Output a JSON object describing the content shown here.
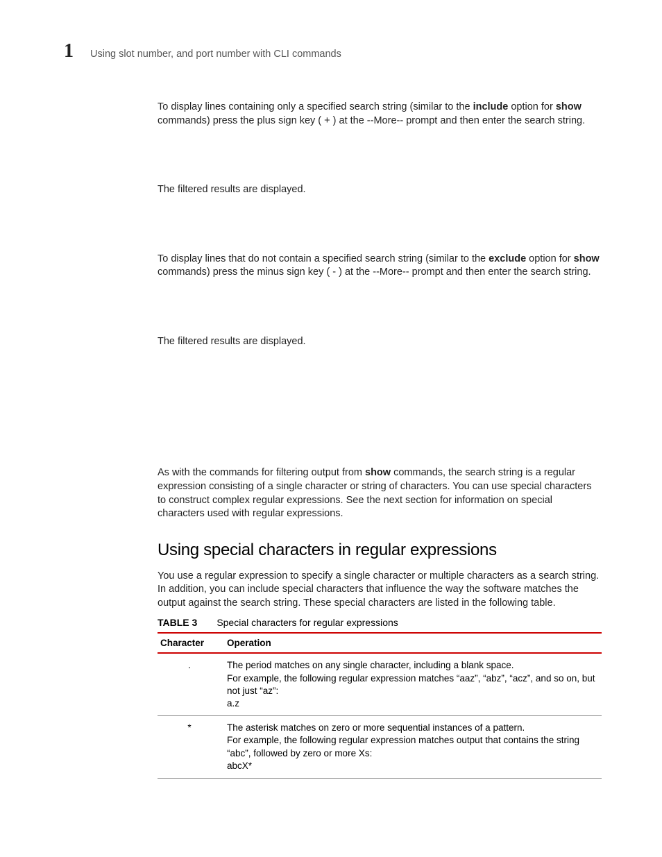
{
  "header": {
    "chapter_number": "1",
    "running_head": "Using slot number, and port number with CLI commands"
  },
  "body": {
    "p1_a": "To display lines containing only a specified search string (similar to the ",
    "p1_b": "include",
    "p1_c": " option for ",
    "p1_d": "show",
    "p1_e": " commands) press the plus sign key ( + ) at the --More-- prompt and then enter the search string.",
    "p2": "The filtered results are displayed.",
    "p3_a": "To display lines that do not contain a specified search string (similar to the ",
    "p3_b": "exclude",
    "p3_c": " option for ",
    "p3_d": "show",
    "p3_e": " commands) press the minus sign key ( - ) at the --More-- prompt and then enter the search string.",
    "p4": "The filtered results are displayed.",
    "p5_a": "As with the commands for filtering output from ",
    "p5_b": "show",
    "p5_c": " commands, the search string is a regular expression consisting of a single character or string of characters.  You can use special characters to construct complex regular expressions.  See the next section for information on special characters used with regular expressions.",
    "section_heading": "Using special characters in regular expressions",
    "p6": "You use a regular expression to specify a single character or multiple characters as a search string.  In addition, you can include special characters that influence the way the software matches the output against the search string.  These special characters are listed in the following table."
  },
  "table": {
    "label": "TABLE 3",
    "caption": "Special characters for regular expressions",
    "col1": "Character",
    "col2": "Operation",
    "rows": [
      {
        "char": ".",
        "op_l1": "The period matches on any single character, including a blank space.",
        "op_l2": "For example, the following regular expression matches “aaz”, “abz”, “acz”, and so on, but not just “az”:",
        "op_l3": "a.z"
      },
      {
        "char": "*",
        "op_l1": "The asterisk matches on zero or more sequential instances of a pattern.",
        "op_l2": "For example, the following regular expression matches output that contains the string “abc”, followed by zero or more Xs:",
        "op_l3": "abcX*"
      }
    ]
  }
}
